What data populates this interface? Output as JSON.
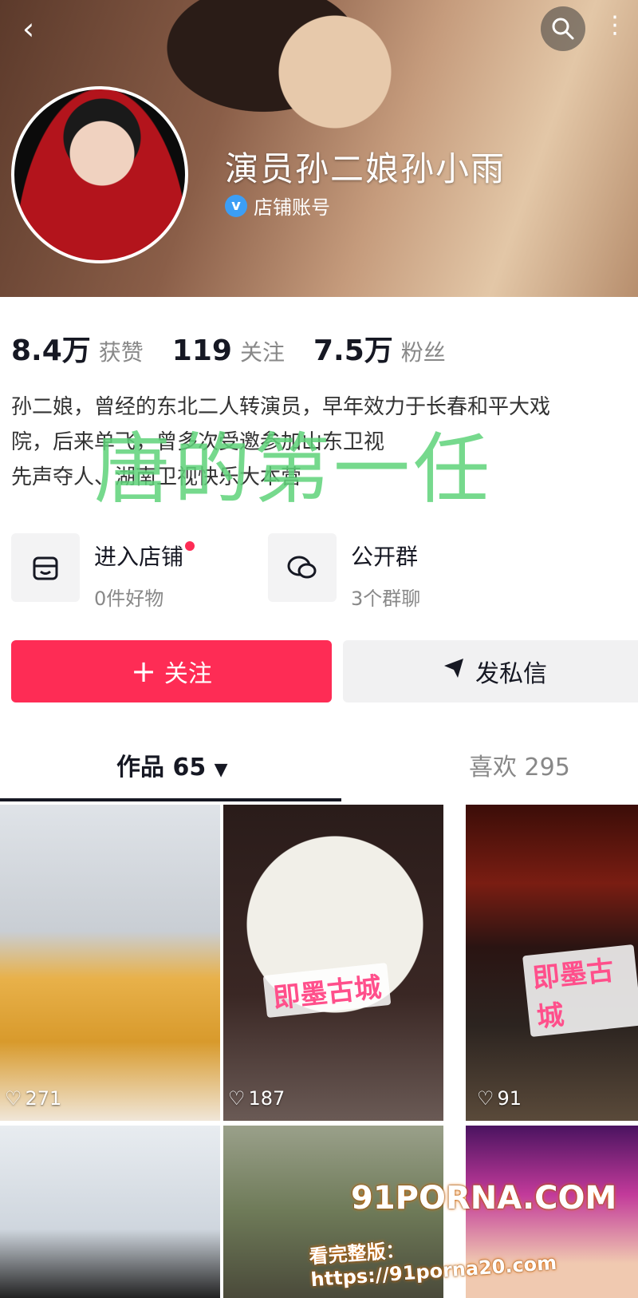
{
  "profile": {
    "name": "演员孙二娘孙小雨",
    "verified_label": "店铺账号"
  },
  "stats": [
    {
      "value": "8.4万",
      "label": "获赞"
    },
    {
      "value": "119",
      "label": "关注"
    },
    {
      "value": "7.5万",
      "label": "粉丝"
    }
  ],
  "bio": {
    "lines": [
      "孙二娘，曾经的东北二人转演员，早年效力于长春和平大戏",
      "院，后来单飞，曾多次受邀参加山东卫视",
      "先声夺人、湖南卫视快乐大本营"
    ],
    "overlay": "唐的第一任"
  },
  "entries": [
    {
      "title": "进入店铺",
      "subtitle": "0件好物",
      "icon": "store-icon"
    },
    {
      "title": "公开群",
      "subtitle": "3个群聊",
      "icon": "group-chat-icon"
    }
  ],
  "buttons": {
    "follow": "关注",
    "message": "发私信"
  },
  "tabs": {
    "works": "作品 65",
    "likes": "喜欢 295"
  },
  "grid": [
    {
      "likes": "271"
    },
    {
      "likes": "187",
      "tag": "即墨古城"
    },
    {
      "likes": "91",
      "tag": "即墨古城"
    },
    {
      "likes": ""
    },
    {
      "likes": ""
    },
    {
      "likes": ""
    }
  ],
  "watermark": {
    "brand": "91PORNA.COM",
    "url": "看完整版：https://91porna20.com"
  },
  "colors": {
    "accent": "#fe2c55",
    "overlay": "#5fd37a"
  }
}
